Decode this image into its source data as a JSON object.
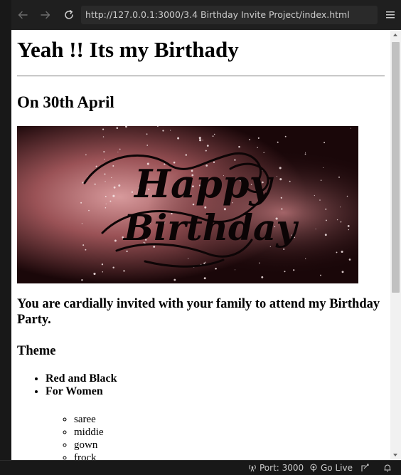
{
  "browser": {
    "url": "http://127.0.0.1:3000/3.4 Birthday Invite Project/index.html",
    "icons": {
      "back": "back-arrow-icon",
      "forward": "forward-arrow-icon",
      "reload": "reload-icon",
      "menu": "hamburger-menu-icon"
    }
  },
  "page": {
    "heading": "Yeah !! Its my Birthady",
    "date_heading": "On 30th April",
    "banner": {
      "text_line1": "Happy",
      "text_line2": "Birthday",
      "colors": {
        "glow": "#c47a7e",
        "dark": "#130608"
      }
    },
    "invite_text": "You are cardially invited with your family to attend my Birthday Party.",
    "theme_heading": "Theme",
    "theme_items": [
      "Red and Black",
      "For Women"
    ],
    "women_items": [
      "saree",
      "middie",
      "gown",
      "frock"
    ]
  },
  "statusbar": {
    "port_label": "Port: 3000",
    "go_live_label": "Go Live",
    "icons": [
      "broadcast-icon",
      "go-live-icon",
      "feedback-icon",
      "bell-icon"
    ]
  }
}
